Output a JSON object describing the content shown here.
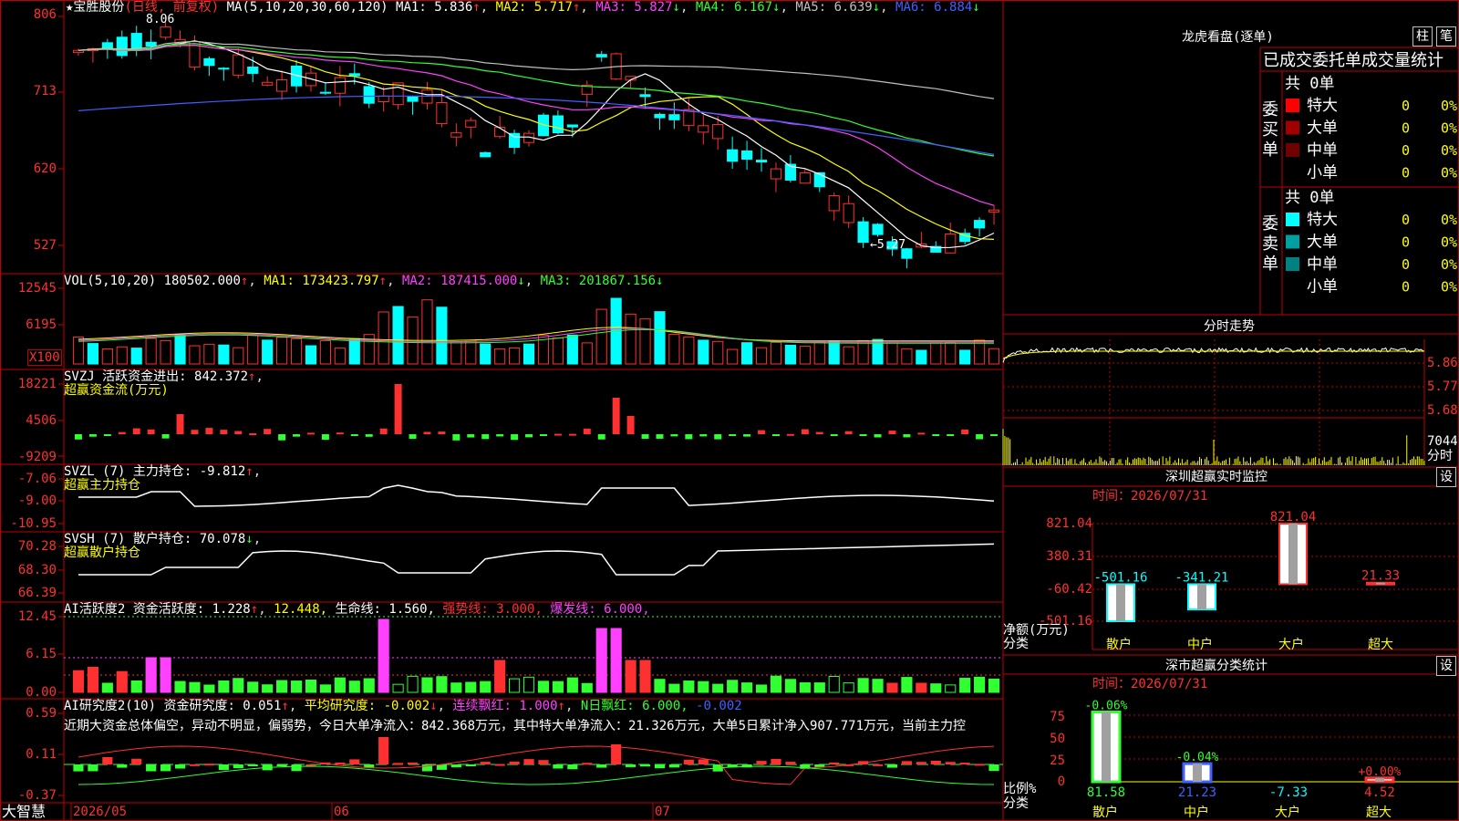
{
  "stock": {
    "name": "★宝胜股份",
    "period": "(日线, 前复权)"
  },
  "colors": {
    "up": "#ff3030",
    "down": "#00ffff",
    "ma1": "#ffffff",
    "ma2": "#ffff00",
    "ma3": "#ff40ff",
    "ma4": "#30ff30",
    "ma5": "#c0c0c0",
    "ma6": "#4060ff",
    "frame": "#c00000"
  },
  "price_panel": {
    "ma_title": "MA(5,10,20,30,60,120)",
    "ma": [
      {
        "label": "MA1: 5.836",
        "arrow": "↑"
      },
      {
        "label": "MA2: 5.717",
        "arrow": "↑"
      },
      {
        "label": "MA3: 5.827",
        "arrow": "↓"
      },
      {
        "label": "MA4: 6.167",
        "arrow": "↓"
      },
      {
        "label": "MA5: 6.639",
        "arrow": "↓"
      },
      {
        "label": "MA6: 6.884",
        "arrow": "↓"
      }
    ],
    "yticks": [
      "806",
      "713",
      "620",
      "527"
    ],
    "high_note": "8.06",
    "low_note": "←5.27"
  },
  "vol_panel": {
    "title": "VOL(5,10,20)",
    "value": "180502.000",
    "ma": [
      {
        "label": "MA1: 173423.797",
        "arrow": "↑"
      },
      {
        "label": "MA2: 187415.000",
        "arrow": "↓"
      },
      {
        "label": "MA3: 201867.156",
        "arrow": "↓"
      }
    ],
    "yticks": [
      "12545",
      "6195"
    ],
    "unit": "X100"
  },
  "svzj_panel": {
    "title": "SVZJ",
    "label": "活跃资金进出: 842.372",
    "arrow": "↑",
    "sub": "超赢资金流(万元)",
    "yticks": [
      "18221",
      "4506",
      "-9209"
    ]
  },
  "svzl_panel": {
    "title": "SVZL (7)",
    "label": "主力持仓: -9.812",
    "arrow": "↑",
    "sub": "超赢主力持仓",
    "yticks": [
      "-7.06",
      "-9.00",
      "-10.95"
    ]
  },
  "svsh_panel": {
    "title": "SVSH (7)",
    "label": "散户持仓: 70.078",
    "arrow": "↓",
    "sub": "超赢散户持仓",
    "yticks": [
      "70.28",
      "68.30",
      "66.39"
    ]
  },
  "ai1_panel": {
    "title": "AI活跃度2",
    "label": "资金活跃度: 1.228",
    "arrow": "↑",
    "val2": "12.448,",
    "life": "生命线: 1.560,",
    "strong": "强势线: 3.000,",
    "burst": "爆发线: 6.000,",
    "yticks": [
      "12.45",
      "6.15",
      "0.00"
    ]
  },
  "ai2_panel": {
    "title": "AI研究度2(10)",
    "label": "资金研究度: 0.051",
    "avg": "平均研究度: -0.002",
    "red": "连续飘红: 1.000",
    "nred": "N日飘红: 6.000,",
    "last": "-0.002",
    "summary": "近期大资金总体偏空，异动不明显，偏弱势，今日大单净流入：842.368万元，其中特大单净流入：21.326万元，大单5日累计净入907.771万元，当前主力控",
    "yticks": [
      "0.59",
      "0.11",
      "-0.37"
    ]
  },
  "xaxis": {
    "labels": [
      "2026/05",
      "06",
      "07"
    ],
    "brand": "大智慧"
  },
  "dragon": {
    "title": "龙虎看盘(逐单)",
    "btn1": "柱",
    "btn2": "笔",
    "header": "已成交委托单成交量统计",
    "buy": {
      "side": "委买单",
      "total": "共 0单",
      "rows": [
        {
          "name": "特大",
          "count": "0",
          "pct": "0%",
          "color": "#ff0000"
        },
        {
          "name": "大单",
          "count": "0",
          "pct": "0%",
          "color": "#a00000"
        },
        {
          "name": "中单",
          "count": "0",
          "pct": "0%",
          "color": "#700000"
        },
        {
          "name": "小单",
          "count": "0",
          "pct": "0%",
          "color": ""
        }
      ]
    },
    "sell": {
      "side": "委卖单",
      "total": "共 0单",
      "rows": [
        {
          "name": "特大",
          "count": "0",
          "pct": "0%",
          "color": "#00ffff"
        },
        {
          "name": "大单",
          "count": "0",
          "pct": "0%",
          "color": "#00a0a0"
        },
        {
          "name": "中单",
          "count": "0",
          "pct": "0%",
          "color": "#008080"
        },
        {
          "name": "小单",
          "count": "0",
          "pct": "0%",
          "color": ""
        }
      ]
    }
  },
  "intraday": {
    "title": "分时走势",
    "prices": [
      "5.86",
      "5.77",
      "5.68"
    ],
    "vol": "7044",
    "vol_label": "分时"
  },
  "monitor": {
    "title": "深圳超赢实时监控",
    "btn": "设",
    "time": "时间：2026/07/31",
    "yticks": [
      "821.04",
      "380.31",
      "-60.42",
      "-501.16"
    ],
    "ylabel1": "净额(万元)",
    "ylabel2": "分类",
    "categories": [
      "散户",
      "中户",
      "大户",
      "超大"
    ]
  },
  "stats": {
    "title": "深市超赢分类统计",
    "btn": "设",
    "time": "时间：2026/07/31",
    "yticks": [
      "75",
      "50",
      "25",
      "0"
    ],
    "ylabel1": "比例%",
    "ylabel2": "分类",
    "categories": [
      "散户",
      "中户",
      "大户",
      "超大"
    ]
  },
  "chart_data": [
    {
      "type": "candlestick",
      "title": "宝胜股份 (日线, 前复权)",
      "ylim": [
        5.2,
        8.1
      ],
      "high": 8.06,
      "low": 5.27,
      "x": [
        "2026/05",
        "06",
        "07"
      ],
      "ma": {
        "MA1": 5.836,
        "MA2": 5.717,
        "MA3": 5.827,
        "MA4": 6.167,
        "MA5": 6.639,
        "MA6": 6.884
      }
    },
    {
      "type": "bar",
      "title": "VOL(5,10,20)",
      "unit": "X100",
      "last": 180502.0,
      "ma": {
        "MA1": 173423.797,
        "MA2": 187415.0,
        "MA3": 201867.156
      },
      "ylim": [
        0,
        13500
      ]
    },
    {
      "type": "bar",
      "title": "超赢实时监控",
      "categories": [
        "散户",
        "中户",
        "大户",
        "超大"
      ],
      "values": [
        -501.16,
        -341.21,
        821.04,
        21.33
      ],
      "ylim": [
        -501.16,
        821.04
      ]
    },
    {
      "type": "bar",
      "title": "深市超赢分类统计",
      "categories": [
        "散户",
        "中户",
        "大户",
        "超大"
      ],
      "values": [
        81.58,
        21.23,
        -7.33,
        4.52
      ],
      "changes": [
        "-0.06%",
        "-0.04%",
        "",
        "+0.00%"
      ],
      "ylim": [
        0,
        80
      ]
    }
  ]
}
